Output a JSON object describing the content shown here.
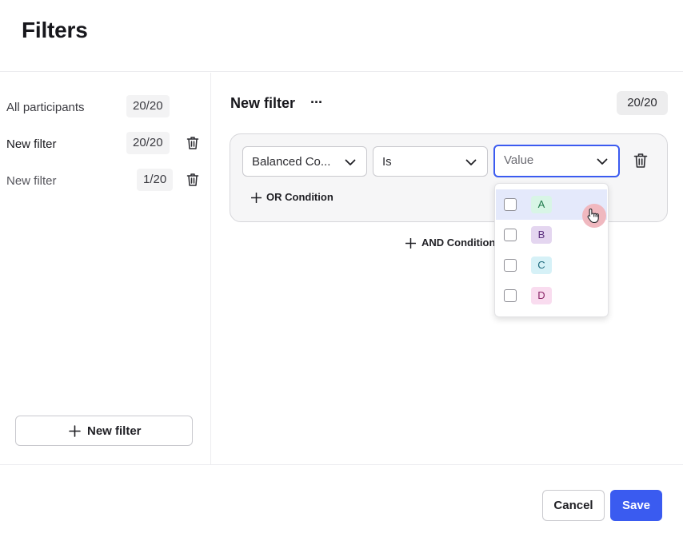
{
  "header": {
    "title": "Filters"
  },
  "sidebar": {
    "items": [
      {
        "label": "All participants",
        "count": "20/20",
        "deletable": false
      },
      {
        "label": "New filter",
        "count": "20/20",
        "deletable": true
      },
      {
        "label": "New filter",
        "count": "1/20",
        "deletable": true
      }
    ],
    "new_filter_label": "New filter"
  },
  "main": {
    "title": "New filter",
    "more_label": "···",
    "count": "20/20",
    "condition": {
      "field": "Balanced Co...",
      "operator": "Is",
      "value_placeholder": "Value"
    },
    "or_condition_label": "OR Condition",
    "and_condition_label": "AND Condition"
  },
  "dropdown": {
    "options": [
      {
        "label": "A",
        "bg": "#d8f5e6",
        "fg": "#1f7a4c",
        "checked": false
      },
      {
        "label": "B",
        "bg": "#e4d6f0",
        "fg": "#5b2f7e",
        "checked": false
      },
      {
        "label": "C",
        "bg": "#d6f1f7",
        "fg": "#1f6b7e",
        "checked": false
      },
      {
        "label": "D",
        "bg": "#f9dcef",
        "fg": "#8a2667",
        "checked": false
      }
    ],
    "hovered_index": 0
  },
  "footer": {
    "cancel_label": "Cancel",
    "save_label": "Save"
  },
  "colors": {
    "accent": "#3a5bf0",
    "hover": "#e4e9fb"
  }
}
